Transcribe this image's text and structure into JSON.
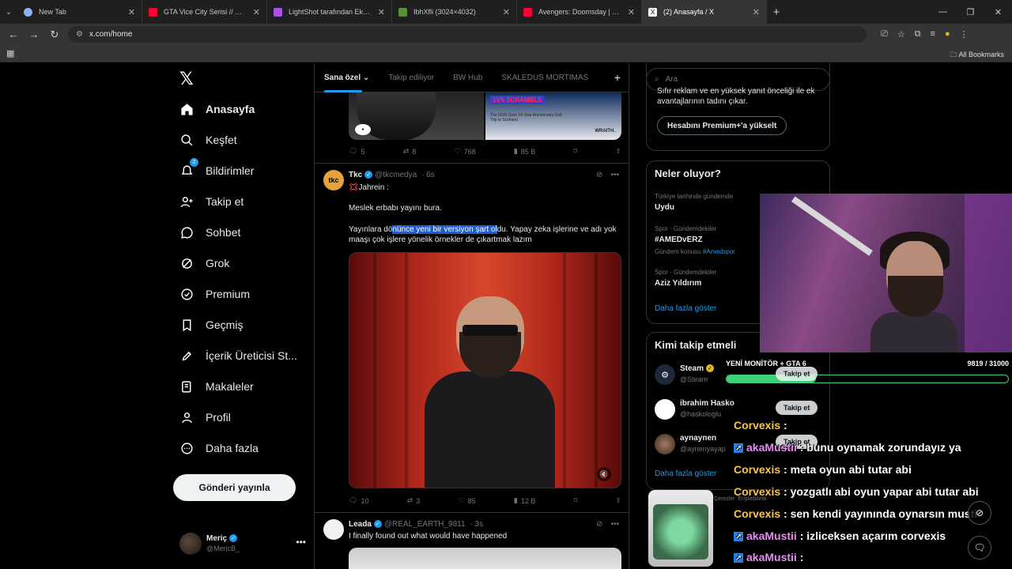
{
  "browser": {
    "tabs": [
      {
        "title": "New Tab",
        "color": "#8ab4f8"
      },
      {
        "title": "GTA Vice City Serisi // Bölüm 1: ...",
        "color": "#ff0033"
      },
      {
        "title": "LightShot tarafından Ekran Görü...",
        "color": "#b04ee8"
      },
      {
        "title": "IbhXfli (3024×4032)",
        "color": "#5a8f3a"
      },
      {
        "title": "Avengers: Doomsday | Dublajlı ...",
        "color": "#ff0033"
      },
      {
        "title": "(2) Anasayfa / X",
        "color": "#ffffff"
      }
    ],
    "url": "x.com/home",
    "all_bookmarks": "All Bookmarks"
  },
  "nav": {
    "logo": "𝕏",
    "items": [
      {
        "label": "Anasayfa",
        "icon": "home-icon"
      },
      {
        "label": "Keşfet",
        "icon": "search-icon"
      },
      {
        "label": "Bildirimler",
        "icon": "bell-icon"
      },
      {
        "label": "Takip et",
        "icon": "add-person-icon"
      },
      {
        "label": "Sohbet",
        "icon": "chat-icon"
      },
      {
        "label": "Grok",
        "icon": "grok-icon"
      },
      {
        "label": "Premium",
        "icon": "premium-icon"
      },
      {
        "label": "Geçmiş",
        "icon": "bookmark-icon"
      },
      {
        "label": "İçerik Üreticisi St...",
        "icon": "rocket-icon"
      },
      {
        "label": "Makaleler",
        "icon": "article-icon"
      },
      {
        "label": "Profil",
        "icon": "person-icon"
      },
      {
        "label": "Daha fazla",
        "icon": "more-icon"
      }
    ],
    "notif_badge": "2",
    "post_button": "Gönderi yayınla",
    "profile": {
      "name": "Meriç",
      "handle": "@MericB_"
    }
  },
  "timeline": {
    "tabs": [
      "Sana özel",
      "Takip ediliyor",
      "BW Hub",
      "SKALEDUS MORTIMAS"
    ],
    "prev_tweet": {
      "media_tag": "1VS SCRAMBLE",
      "media_caption": "The 2016 Cavs 10-Year Anniversary Golf Trip to Scotland",
      "media_brand": "WRAITH.",
      "stats": {
        "replies": "5",
        "reposts": "8",
        "likes": "768",
        "views": "85 B"
      }
    },
    "tweet1": {
      "name": "Tkc",
      "handle": "@tkcmedya",
      "time": "· 6s",
      "avatar_text": "tkc",
      "line1": "💢Jahrein :",
      "line2": "Meslek erbabı yayını bura.",
      "line3_pre": "Yayınlara dö",
      "line3_sel": "nünce yeni bir versiyon şart ol",
      "line3_post": "du. Yapay zeka işlerine ve adı yok maaşı çok işlere yönelik örnekler de çıkartmak lazım",
      "stats": {
        "replies": "10",
        "reposts": "3",
        "likes": "85",
        "views": "12 B"
      }
    },
    "tweet2": {
      "name": "Leada",
      "handle": "@REAL_EARTH_9811",
      "time": "· 3s",
      "text": "I finally found out what would have happened"
    }
  },
  "right": {
    "search_placeholder": "Ara",
    "premium_text": "Sıfır reklam ve en yüksek yanıt önceliği ile ek avantajlarının tadını çıkar.",
    "premium_button": "Hesabını Premium+'a yükselt",
    "trends_title": "Neler oluyor?",
    "trends": [
      {
        "meta": "Türkiye tarihinde gündemde",
        "name": "Uydu"
      },
      {
        "meta": "Spor · Gündemdekiler",
        "name": "#AMEDvERZ",
        "sub": "Gündem konusu",
        "sublink": "#Amedspor"
      },
      {
        "meta": "Spor · Gündemdekiler",
        "name": "Aziz Yıldırım"
      }
    ],
    "show_more": "Daha fazla göster",
    "who_title": "Kimi takip etmeli",
    "who": [
      {
        "name": "Steam",
        "handle": "@Steam"
      },
      {
        "name": "ibrahim Hasko",
        "handle": "@haskologlu"
      },
      {
        "name": "aynaynen",
        "handle": "@aynenyayap"
      }
    ],
    "follow_label": "Takip et",
    "footer_bits": [
      "Çerezler",
      "Erişilebilirlik"
    ]
  },
  "stream_overlay": {
    "goal_title": "YENİ MONİTÖR + GTA 6",
    "goal_count": "9819 / 31000",
    "goal_fraction": 0.317,
    "chat": [
      {
        "user": "Corvexis",
        "msg": ":"
      },
      {
        "user": "akaMustii",
        "msg": ": bunu oynamak zorundayız ya",
        "badge": true
      },
      {
        "user": "Corvexis",
        "msg": ": meta oyun abi tutar abi"
      },
      {
        "user": "Corvexis",
        "msg": ": yozgatlı abi oyun yapar abi tutar abi"
      },
      {
        "user": "Corvexis",
        "msg": ": sen kendi yayınında oynarsın musti"
      },
      {
        "user": "akaMustii",
        "msg": ": izliceksen açarım corvexis",
        "badge": true
      },
      {
        "user": "akaMustii",
        "msg": ":",
        "badge": true
      }
    ]
  }
}
